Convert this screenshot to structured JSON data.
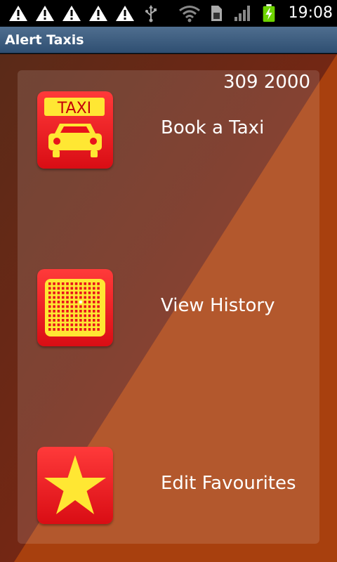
{
  "status_bar": {
    "time": "19:08",
    "icons": [
      "warning-icon",
      "warning-icon",
      "warning-icon",
      "warning-icon",
      "warning-icon",
      "usb-icon",
      "wifi-icon",
      "sim-icon",
      "signal-icon",
      "battery-charging-icon"
    ]
  },
  "app": {
    "title": "Alert Taxis",
    "phone": "309 2000"
  },
  "menu": [
    {
      "label": "Book a Taxi",
      "icon": "taxi-icon",
      "icon_text": "TAXI"
    },
    {
      "label": "View History",
      "icon": "history-grid-icon"
    },
    {
      "label": "Edit Favourites",
      "icon": "star-icon"
    }
  ],
  "colors": {
    "titlebar": "#3c5d82",
    "icon_red": "#e8141b",
    "icon_yellow": "#ffe733"
  }
}
